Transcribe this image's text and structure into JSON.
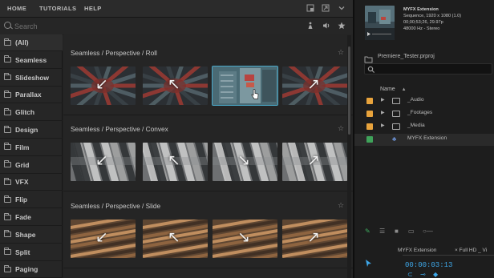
{
  "extension": {
    "tabs": [
      "HOME",
      "TUTORIALS",
      "HELP"
    ],
    "toolbar_icons": [
      "window-icon",
      "detach-icon",
      "chevron-down-icon"
    ],
    "search": {
      "placeholder": "Search"
    },
    "search_tools": [
      "figure-icon",
      "volume-icon",
      "star-icon"
    ],
    "categories": [
      "(All)",
      "Seamless",
      "Slideshow",
      "Parallax",
      "Glitch",
      "Design",
      "Film",
      "Grid",
      "VFX",
      "Flip",
      "Fade",
      "Shape",
      "Split",
      "Paging"
    ],
    "active_category": 0,
    "sections": [
      {
        "title": "Seamless / Perspective / Roll",
        "arrows": [
          "↙",
          "↖",
          "",
          "↗"
        ],
        "selected": 2,
        "style": "roll"
      },
      {
        "title": "Seamless / Perspective / Convex",
        "arrows": [
          "↙",
          "↖",
          "↘",
          "↗"
        ],
        "selected": -1,
        "style": "convex"
      },
      {
        "title": "Seamless / Perspective / Slide",
        "arrows": [
          "↙",
          "↖",
          "↘",
          "↗"
        ],
        "selected": -1,
        "style": "slide"
      }
    ],
    "colors": {
      "accent": "#4aa8c8",
      "background": "#232323",
      "sidebar": "#262626"
    }
  },
  "premiere": {
    "sequence_info": [
      "MYFX Extension",
      "Sequence, 1920 x 1080 (1.0)",
      "00;00;53;26, 29.97p",
      "48000 Hz - Stereo"
    ],
    "project_name": "Premiere_Tester.prproj",
    "column_name": "Name",
    "rows": [
      {
        "label": "_Audio",
        "chip": "#e8a33c",
        "kind": "folder"
      },
      {
        "label": "_Footages",
        "chip": "#e8a33c",
        "kind": "folder"
      },
      {
        "label": "_Media",
        "chip": "#e8a33c",
        "kind": "folder"
      },
      {
        "label": "MYFX Extension",
        "chip": "#3fa35a",
        "kind": "sequence"
      }
    ],
    "timeline_tab": "MYFX Extension",
    "timeline_dropdown": "Full HD _ Vi",
    "timecode": "00:00:03:13",
    "colors": {
      "timecode": "#3ea7e8",
      "folder_chip": "#e8a33c",
      "sequence_chip": "#3fa35a"
    }
  }
}
